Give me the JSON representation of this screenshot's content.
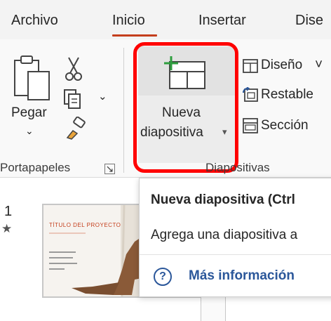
{
  "tabs": [
    {
      "label": "Archivo"
    },
    {
      "label": "Inicio"
    },
    {
      "label": "Insertar"
    },
    {
      "label": "Dise"
    }
  ],
  "ribbon": {
    "clipboard": {
      "paste_label": "Pegar",
      "group_label": "Portapapeles",
      "launcher_glyph": "↘"
    },
    "slides": {
      "new_slide_line1": "Nueva",
      "new_slide_line2": "diapositiva",
      "new_slide_arrow": "▾",
      "layout_label": "Diseño",
      "layout_arrow": "˅",
      "reset_label": "Restable",
      "section_label": "Sección",
      "group_label": "Diapositivas"
    }
  },
  "slide_pane": {
    "slide_number": "1",
    "star_glyph": "★",
    "thumb_title": "TÍTULO DEL PROYECTO"
  },
  "tooltip": {
    "title": "Nueva diapositiva (Ctrl",
    "description": "Agrega una diapositiva a",
    "help_glyph": "?",
    "link_label": "Más información"
  },
  "colors": {
    "accent": "#c43e1c",
    "highlight_box": "#ff0000",
    "link": "#2b579a",
    "icon_green": "#2e9e3e"
  }
}
